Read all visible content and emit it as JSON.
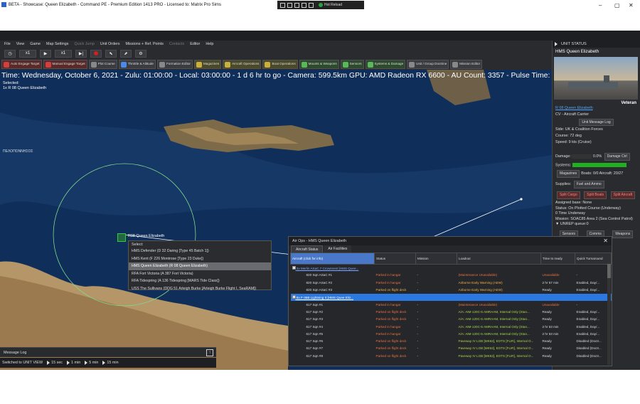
{
  "window": {
    "title": "BETA - Showcase: Queen Elizabeth - Command PE - Premium Edition 1413 PRO - Licensed to: Matrix Pro Sims",
    "hot_reload": "Hot Reload"
  },
  "menu": [
    "File",
    "View",
    "Game",
    "Map Settings",
    "Quick Jump",
    "Unit Orders",
    "Missions + Ref. Points",
    "Contacts",
    "Editor",
    "Help"
  ],
  "time_controls": {
    "speed1": "x1",
    "speed2": "x1"
  },
  "toolbar": [
    "Auto Engage Target",
    "Manual Engage Target",
    "Plot Course",
    "Throttle & Altitude",
    "Formation Editor",
    "Magazines",
    "Aircraft Operations",
    "Boat Operations",
    "Mounts & Weapons",
    "Sensors",
    "Systems & Damage",
    "Unit / Group Doctrine",
    "Mission Editor"
  ],
  "status_line": "Time: Wednesday, October 6, 2021 - Zulu: 01:00:00 - Local: 03:00:00 - 1 d 6 hr to go - Camera: 599.5km GPU: AMD Radeon RX 6600 - AU Count: 3357 - Pulse Time: 0ms",
  "selected": {
    "label": "Selected:",
    "unit": "1x R 08 Queen Elizabeth"
  },
  "map": {
    "ship_label": "R08 Queen Elizabeth",
    "context_menu": {
      "header": "Select:",
      "items": [
        "HMS Defender (D 32 Daring [Type 45 Batch 1])",
        "HMS Kent (F 226 Montrose [Type 23 Duke])",
        "HMS Queen Elizabeth (R 08 Queen Elizabeth)",
        "RFA Fort Victoria (A 387 Fort Victoria)",
        "RFA Tidespring (A 136 Tidespring [MARS Tide Class])",
        "USS The Sullivans (DDG 51 Arleigh Burke [Arleigh Burke Flight I, SeaRAM])"
      ],
      "highlighted": 2
    }
  },
  "message_log": "Message Log",
  "timestep": {
    "label": "Switched to UNIT VIEW",
    "steps": [
      "15 sec",
      "1 min",
      "5 min",
      "15 min"
    ]
  },
  "unit_status": {
    "header": "UNIT STATUS",
    "name": "HMS Queen Elizabeth",
    "veteran": "Veteran",
    "class_link": "R 08 Queen Elizabeth",
    "type": "CV - Aircraft Carrier",
    "msg_log_btn": "Unit Message Log",
    "side": "Side: UK & Coalition Forces",
    "course": "Course: 72 deg",
    "speed": "Speed: 9 kts (Cruise)",
    "damage_label": "Damage:",
    "damage_value": "0.0%",
    "damage_btn": "Damage Ctrl",
    "systems_label": "Systems:",
    "magazines": "Magazines",
    "boats": "Boats: 0/0",
    "aircraft": "Aircraft: 20/27",
    "supplies_label": "Supplies:",
    "supplies_value": "Fuel and Ammo",
    "split_btns": [
      "Split Cargo",
      "Split Boats",
      "Split Aircraft"
    ],
    "assigned_base": "Assigned base: None",
    "status": "Status: On Plotted Course (Underway)",
    "time_underway": "0 Time Underway",
    "mission": "Mission: SOAC85 Area 2 (Sea Control Patrol)",
    "unrep": "UNREP queue:0",
    "tabs": [
      "Sensors",
      "Comms",
      "Weapons"
    ]
  },
  "air_ops": {
    "title": "Air Ops - HMS Queen Elizabeth",
    "tabs": [
      "Aircraft Status",
      "Air Facilities"
    ],
    "columns": [
      "Aircraft (click for info)",
      "Status",
      "Mission",
      "Loadout",
      "Time to ready",
      "Quick Turnaround"
    ],
    "rows": [
      {
        "kind": "group",
        "name": "3x Merlin ASaC.7 Crowsnest [HMS Quee...",
        "status": "",
        "mission": "",
        "loadout": "",
        "ttr": "",
        "qt": ""
      },
      {
        "kind": "ac",
        "name": "820 Sqn ASaC #1",
        "status": "Parked in hangar",
        "sc": "c-hangar",
        "mission": "-",
        "loadout": "(Maintenance Unavailable)",
        "lc": "c-mint",
        "ttr": "Unavailable",
        "tc": "c-unav",
        "qt": "-"
      },
      {
        "kind": "ac",
        "name": "820 Sqn ASaC #2",
        "status": "Parked in hangar",
        "sc": "c-hangar",
        "mission": "-",
        "loadout": "Airborne Early Warning (AEW)",
        "lc": "c-aew",
        "ttr": "2 hr 57 min",
        "tc": "c-time",
        "qt": "Enabled, Day/..."
      },
      {
        "kind": "ac",
        "name": "820 Sqn ASaC #3",
        "status": "Parked on flight deck",
        "sc": "c-deck2",
        "mission": "-",
        "loadout": "Airborne Early Warning (AEW)",
        "lc": "c-aew",
        "ttr": "Ready",
        "tc": "c-ready",
        "qt": "Enabled, Day/..."
      },
      {
        "kind": "group",
        "sel": true,
        "name": "8x F-35B Lightning II [HMS Quee Eliz...",
        "status": "",
        "mission": "",
        "loadout": "",
        "ttr": "",
        "qt": ""
      },
      {
        "kind": "ac",
        "name": "617 Sqn #1",
        "status": "Parked in hangar",
        "sc": "c-hangar",
        "mission": "-",
        "loadout": "(Maintenance Unavailable)",
        "lc": "c-mint",
        "ttr": "Unavailable",
        "tc": "c-unav",
        "qt": "-"
      },
      {
        "kind": "ac",
        "name": "617 Sqn #2",
        "status": "Parked on flight deck",
        "sc": "c-deck",
        "mission": "-",
        "loadout": "A/A: AIM-120C-5 AMRAAM, Internal Only (Stan...",
        "lc": "c-green",
        "ttr": "Ready",
        "tc": "c-ready",
        "qt": "Enabled, Day/..."
      },
      {
        "kind": "ac",
        "name": "617 Sqn #3",
        "status": "Parked on flight deck",
        "sc": "c-deck",
        "mission": "-",
        "loadout": "A/A: AIM-120C-5 AMRAAM, Internal Only (Stan...",
        "lc": "c-green",
        "ttr": "Ready",
        "tc": "c-ready",
        "qt": "Enabled, Day/..."
      },
      {
        "kind": "ac",
        "name": "617 Sqn #4",
        "status": "Parked in hangar",
        "sc": "c-hangar",
        "mission": "-",
        "loadout": "A/A: AIM-120C-5 AMRAAM, Internal Only (Stan...",
        "lc": "c-green",
        "ttr": "2 hr 53 min",
        "tc": "c-time",
        "qt": "Enabled, Day/..."
      },
      {
        "kind": "ac",
        "name": "617 Sqn #5",
        "status": "Parked in hangar",
        "sc": "c-hangar",
        "mission": "-",
        "loadout": "A/A: AIM-120C-5 AMRAAM, Internal Only (Stan...",
        "lc": "c-green",
        "ttr": "2 hr 53 min",
        "tc": "c-time",
        "qt": "Enabled, Day/..."
      },
      {
        "kind": "ac",
        "name": "617 Sqn #6",
        "status": "Parked on flight deck",
        "sc": "c-deck",
        "mission": "-",
        "loadout": "Paveway IV LGB [MK62], EOTS [FLIR], Internal O...",
        "lc": "c-green",
        "ttr": "Ready",
        "tc": "c-ready",
        "qt": "Disabled (Doctr..."
      },
      {
        "kind": "ac",
        "name": "617 Sqn #7",
        "status": "Parked on flight deck",
        "sc": "c-deck",
        "mission": "-",
        "loadout": "Paveway IV LGB [MK62], EOTS [FLIR], Internal O...",
        "lc": "c-green",
        "ttr": "Ready",
        "tc": "c-ready",
        "qt": "Disabled (Doctr..."
      },
      {
        "kind": "ac",
        "name": "617 Sqn #8",
        "status": "Parked on flight deck",
        "sc": "c-deck",
        "mission": "-",
        "loadout": "Paveway IV LGB [MK62], EOTS [FLIR], Internal O...",
        "lc": "c-green",
        "ttr": "Ready",
        "tc": "c-ready",
        "qt": "Disabled (Doctr..."
      }
    ]
  }
}
